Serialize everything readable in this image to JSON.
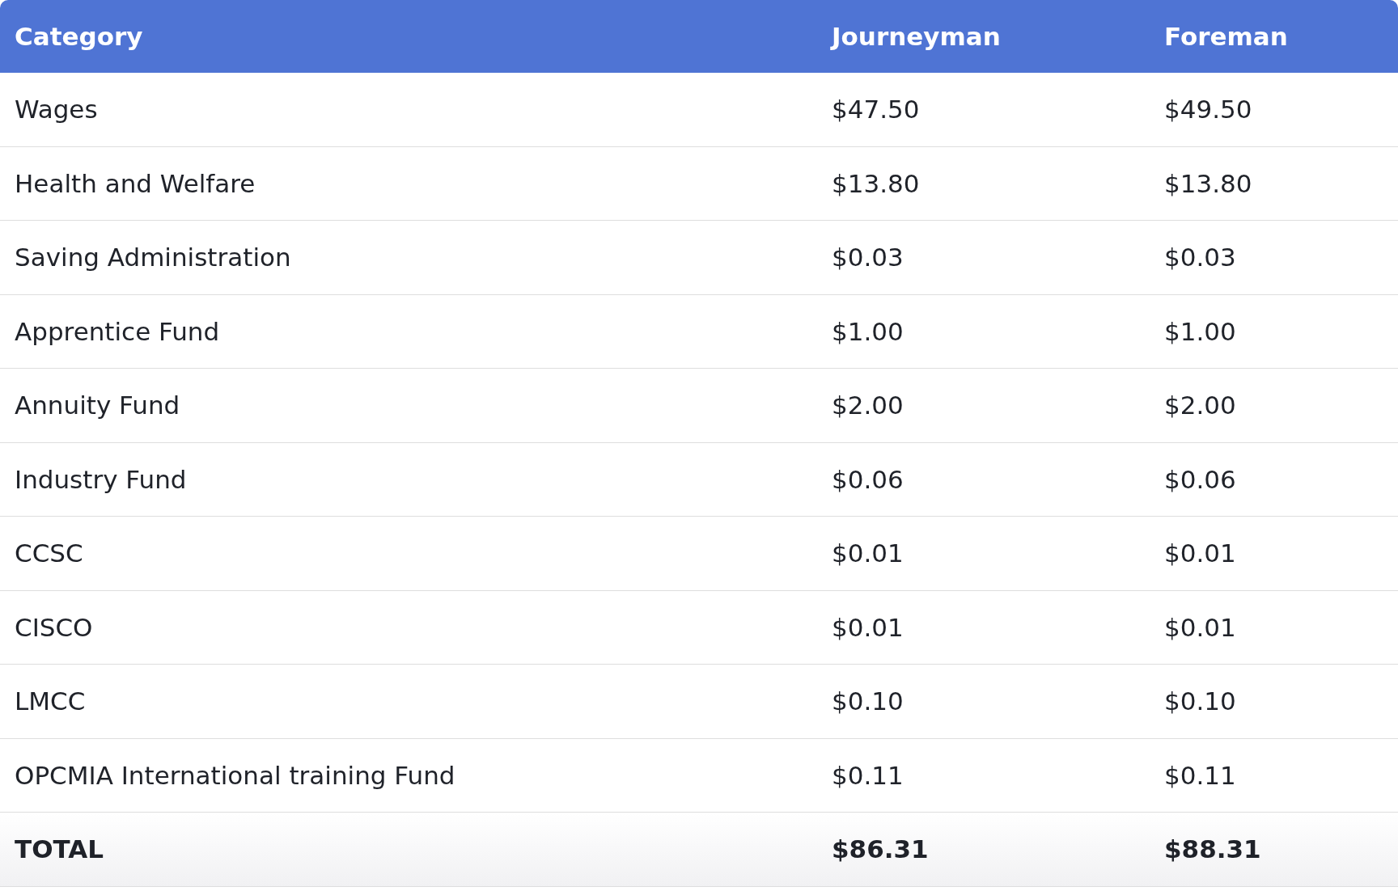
{
  "table": {
    "columns": [
      "Category",
      "Journeyman",
      "Foreman"
    ],
    "rows": [
      [
        "Wages",
        "$47.50",
        "$49.50"
      ],
      [
        "Health and Welfare",
        "$13.80",
        "$13.80"
      ],
      [
        "Saving Administration",
        "$0.03",
        "$0.03"
      ],
      [
        "Apprentice Fund",
        "$1.00",
        "$1.00"
      ],
      [
        "Annuity Fund",
        "$2.00",
        "$2.00"
      ],
      [
        "Industry Fund",
        "$0.06",
        "$0.06"
      ],
      [
        "CCSC",
        "$0.01",
        "$0.01"
      ],
      [
        "CISCO",
        "$0.01",
        "$0.01"
      ],
      [
        "LMCC",
        "$0.10",
        "$0.10"
      ],
      [
        "OPCMIA International training Fund",
        "$0.11",
        "$0.11"
      ]
    ],
    "total": [
      "TOTAL",
      "$86.31",
      "$88.31"
    ]
  }
}
